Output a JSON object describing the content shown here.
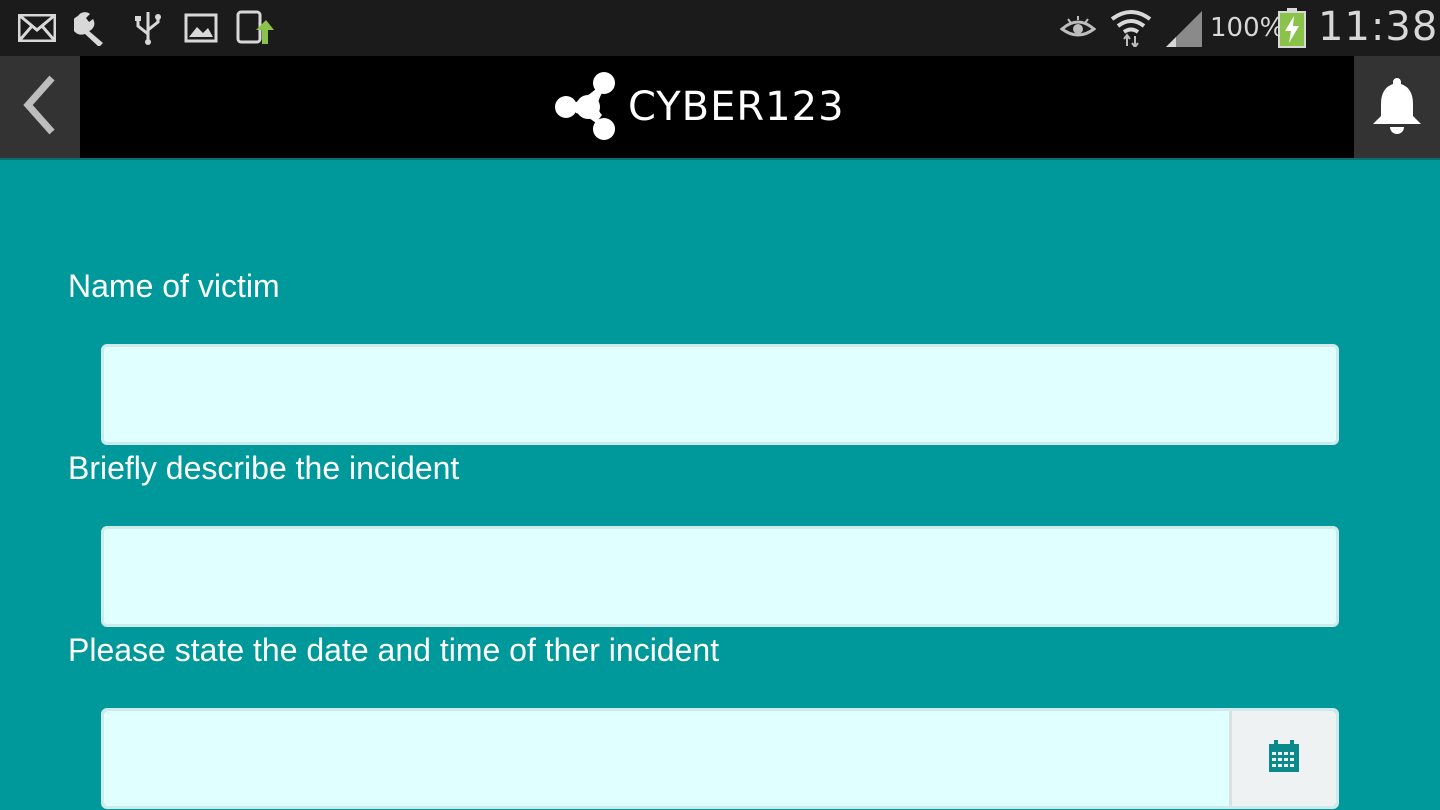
{
  "status_bar": {
    "icons": [
      "mail-icon",
      "wrench-icon",
      "usb-icon",
      "image-icon",
      "upload-icon",
      "eye-icon",
      "wifi-icon",
      "signal-icon",
      "battery-charging-icon"
    ],
    "battery": "100%",
    "time": "11:38"
  },
  "app_bar": {
    "logo_text": "CYBER123",
    "back_icon": "chevron-left-icon",
    "notification_icon": "bell-icon"
  },
  "form": {
    "victim_label": "Name of victim",
    "victim_value": "",
    "incident_label": "Briefly describe the incident",
    "incident_value": "",
    "datetime_label": "Please state the date and time of ther incident",
    "datetime_value": "",
    "calendar_icon": "calendar-icon"
  },
  "colors": {
    "background": "#00999b",
    "input_background": "#e0ffff",
    "app_bar": "#000000",
    "status_bar": "#1b1b1b",
    "accent_calendar": "#0b8a8c"
  }
}
